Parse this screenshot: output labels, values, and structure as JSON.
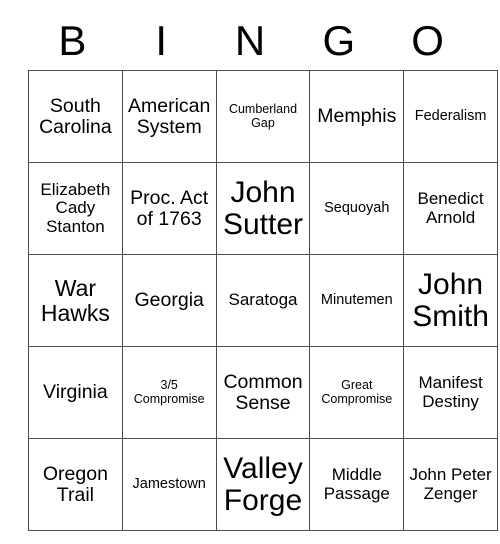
{
  "card": {
    "title_letters": [
      "B",
      "I",
      "N",
      "G",
      "O"
    ],
    "columns": 5,
    "rows": 5,
    "border_color": "#4d4d4d",
    "background_color": "#ffffff",
    "text_color": "#000000",
    "cells": [
      [
        {
          "text": "South Carolina",
          "size": "s-lg"
        },
        {
          "text": "American System",
          "size": "s-lg"
        },
        {
          "text": "Cumberland Gap",
          "size": "s-xs"
        },
        {
          "text": "Memphis",
          "size": "s-lg"
        },
        {
          "text": "Federalism",
          "size": "s-sm"
        }
      ],
      [
        {
          "text": "Elizabeth Cady Stanton",
          "size": "s-md"
        },
        {
          "text": "Proc. Act of 1763",
          "size": "s-lg"
        },
        {
          "text": "John Sutter",
          "size": "s-xxl"
        },
        {
          "text": "Sequoyah",
          "size": "s-sm"
        },
        {
          "text": "Benedict Arnold",
          "size": "s-md"
        }
      ],
      [
        {
          "text": "War Hawks",
          "size": "s-xl"
        },
        {
          "text": "Georgia",
          "size": "s-lg"
        },
        {
          "text": "Saratoga",
          "size": "s-md"
        },
        {
          "text": "Minutemen",
          "size": "s-sm"
        },
        {
          "text": "John Smith",
          "size": "s-xxl"
        }
      ],
      [
        {
          "text": "Virginia",
          "size": "s-lg"
        },
        {
          "text": "3/5 Compromise",
          "size": "s-xs"
        },
        {
          "text": "Common Sense",
          "size": "s-lg"
        },
        {
          "text": "Great Compromise",
          "size": "s-xs"
        },
        {
          "text": "Manifest Destiny",
          "size": "s-md"
        }
      ],
      [
        {
          "text": "Oregon Trail",
          "size": "s-lg"
        },
        {
          "text": "Jamestown",
          "size": "s-sm"
        },
        {
          "text": "Valley Forge",
          "size": "s-xxl"
        },
        {
          "text": "Middle Passage",
          "size": "s-md"
        },
        {
          "text": "John Peter Zenger",
          "size": "s-md"
        }
      ]
    ]
  }
}
